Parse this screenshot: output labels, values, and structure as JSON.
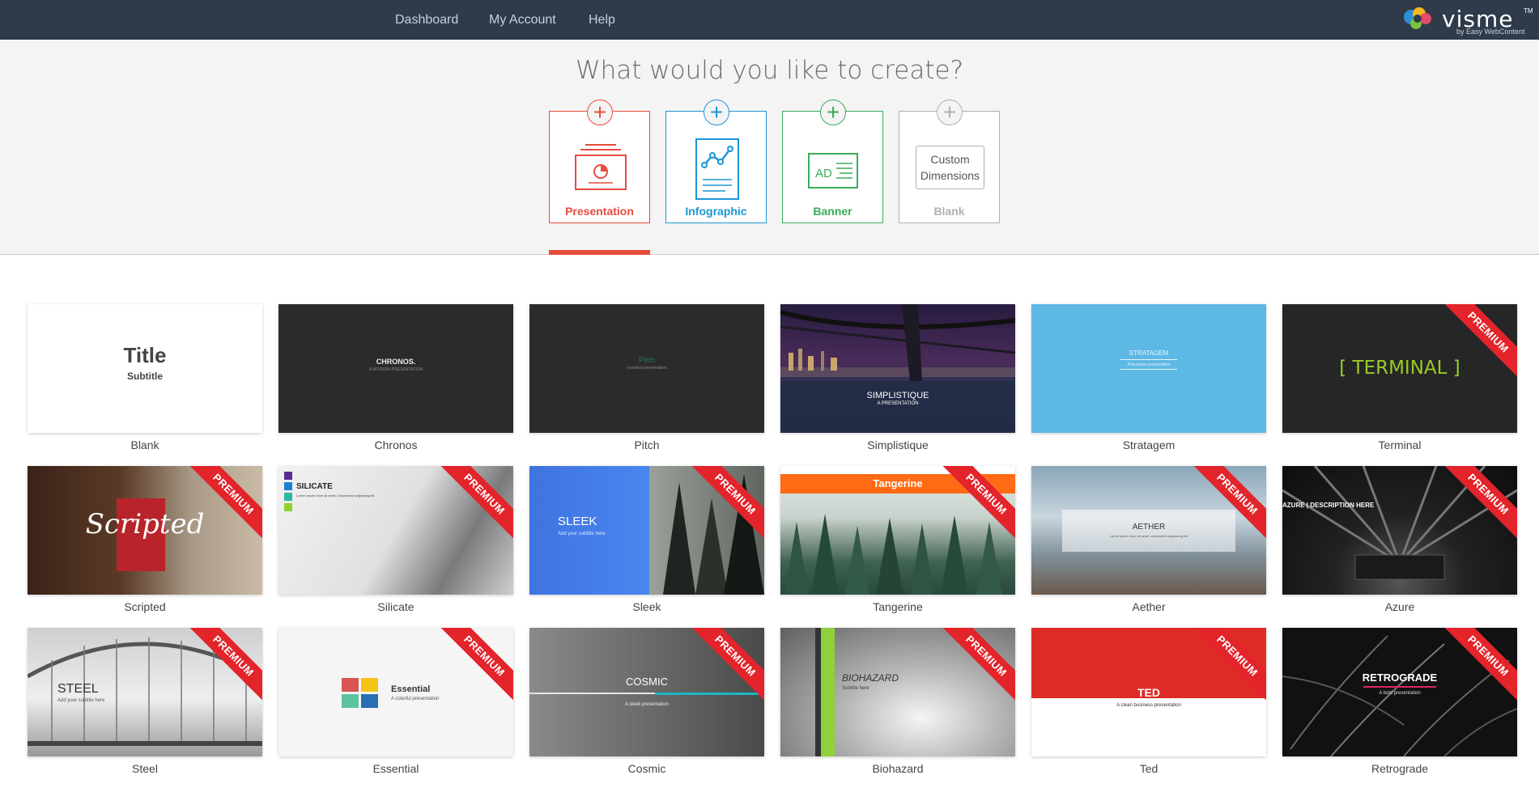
{
  "nav": {
    "links": [
      "Dashboard",
      "My Account",
      "Help"
    ],
    "logo_word": "visme",
    "logo_tm": "TM",
    "logo_sub": "by Easy WebContent"
  },
  "hero": {
    "title": "What would you like to create?",
    "types": [
      {
        "label": "Presentation",
        "color": "#e74c3c",
        "selected": true
      },
      {
        "label": "Infographic",
        "color": "#1a96d4",
        "selected": false
      },
      {
        "label": "Banner",
        "color": "#3aab59",
        "selected": false
      },
      {
        "label": "Blank",
        "color": "#b0b0b0",
        "selected": false,
        "inner_text": "Custom Dimensions"
      }
    ],
    "banner_ad": "AD"
  },
  "templates": [
    {
      "name": "Blank",
      "title": "Title",
      "subtitle": "Subtitle",
      "premium": false
    },
    {
      "name": "Chronos",
      "title": "CHRONOS.",
      "subtitle": "A MODERN PRESENTATION",
      "premium": false
    },
    {
      "name": "Pitch",
      "title": "Pitch",
      "subtitle": "a product presentation",
      "premium": false
    },
    {
      "name": "Simplistique",
      "title": "SIMPLISTIQUE",
      "subtitle": "A PRESENTATION",
      "premium": false
    },
    {
      "name": "Stratagem",
      "title": "STRATAGEM",
      "subtitle": "A business presentation",
      "premium": false
    },
    {
      "name": "Terminal",
      "title": "[ TERMINAL ]",
      "subtitle": "",
      "premium": true
    },
    {
      "name": "Scripted",
      "title": "Scripted",
      "subtitle": "",
      "premium": true
    },
    {
      "name": "Silicate",
      "title": "SILICATE",
      "subtitle": "Lorem ipsum dolor sit amet, consectetur adipiscing elit",
      "premium": true
    },
    {
      "name": "Sleek",
      "title": "SLEEK",
      "subtitle": "Add your subtitle here",
      "premium": true
    },
    {
      "name": "Tangerine",
      "title": "Tangerine",
      "subtitle": "",
      "premium": true
    },
    {
      "name": "Aether",
      "title": "AETHER",
      "subtitle": "Lorem ipsum dolor sit amet, consectetur adipiscing elit",
      "premium": true
    },
    {
      "name": "Azure",
      "title": "AZURE | DESCRIPTION HERE",
      "subtitle": "",
      "premium": true
    },
    {
      "name": "Steel",
      "title": "STEEL",
      "subtitle": "Add your subtitle here",
      "premium": true
    },
    {
      "name": "Essential",
      "title": "Essential",
      "subtitle": "A colorful presentation",
      "premium": true
    },
    {
      "name": "Cosmic",
      "title": "COSMIC",
      "subtitle": "A sleek presentation",
      "premium": true
    },
    {
      "name": "Biohazard",
      "title": "BIOHAZARD",
      "subtitle": "Subtitle here",
      "premium": true
    },
    {
      "name": "Ted",
      "title": "TED",
      "subtitle": "A clean business presentation",
      "premium": true
    },
    {
      "name": "Retrograde",
      "title": "RETROGRADE",
      "subtitle": "A bold presentation",
      "premium": true
    }
  ],
  "premium_label": "PREMIUM",
  "colors": {
    "nav_bg": "#2f3a4a",
    "presentation": "#e74c3c",
    "infographic": "#1a96d4",
    "banner": "#3aab59",
    "ribbon": "#e3242b"
  }
}
